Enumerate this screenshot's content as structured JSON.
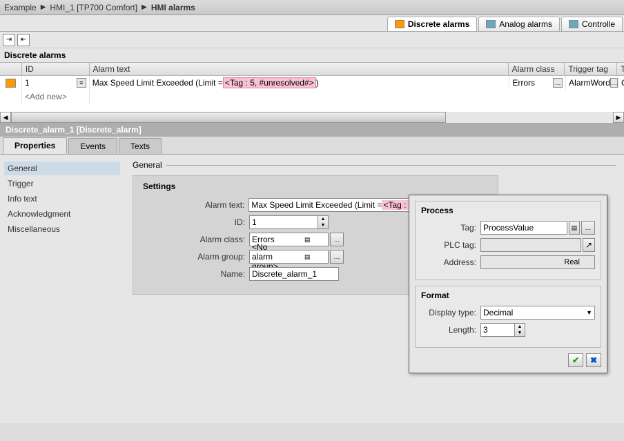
{
  "breadcrumb": {
    "a": "Example",
    "b": "HMI_1 [TP700 Comfort]",
    "c": "HMI alarms"
  },
  "topTabs": {
    "discrete": "Discrete alarms",
    "analog": "Analog alarms",
    "controller": "Controlle"
  },
  "section": "Discrete alarms",
  "columns": {
    "id": "ID",
    "text": "Alarm text",
    "class": "Alarm class",
    "trigger": "Trigger tag",
    "t": "T"
  },
  "row1": {
    "id": "1",
    "textPrefix": "Max Speed Limit Exceeded (Limit = ",
    "textTag": "<Tag : 5, #unresolved#>",
    "textSuffix": ")",
    "class": "Errors",
    "trigger": "AlarmWord"
  },
  "addnew": "<Add new>",
  "panelTitle": "Discrete_alarm_1 [Discrete_alarm]",
  "propTabs": {
    "properties": "Properties",
    "events": "Events",
    "texts": "Texts"
  },
  "nav": {
    "general": "General",
    "trigger": "Trigger",
    "info": "Info text",
    "ack": "Acknowledgment",
    "misc": "Miscellaneous"
  },
  "general": {
    "header": "General",
    "settings": "Settings",
    "alarmTextLbl": "Alarm text:",
    "idLbl": "ID:",
    "idVal": "1",
    "classLbl": "Alarm class:",
    "classVal": "Errors",
    "groupLbl": "Alarm group:",
    "groupVal": "<No alarm group>",
    "nameLbl": "Name:",
    "nameVal": "Discrete_alarm_1"
  },
  "popup": {
    "process": "Process",
    "tagLbl": "Tag:",
    "tagVal": "ProcessValue",
    "plcLbl": "PLC tag:",
    "addrLbl": "Address:",
    "addrType": "Real",
    "format": "Format",
    "dispLbl": "Display type:",
    "dispVal": "Decimal",
    "lenLbl": "Length:",
    "lenVal": "3"
  }
}
